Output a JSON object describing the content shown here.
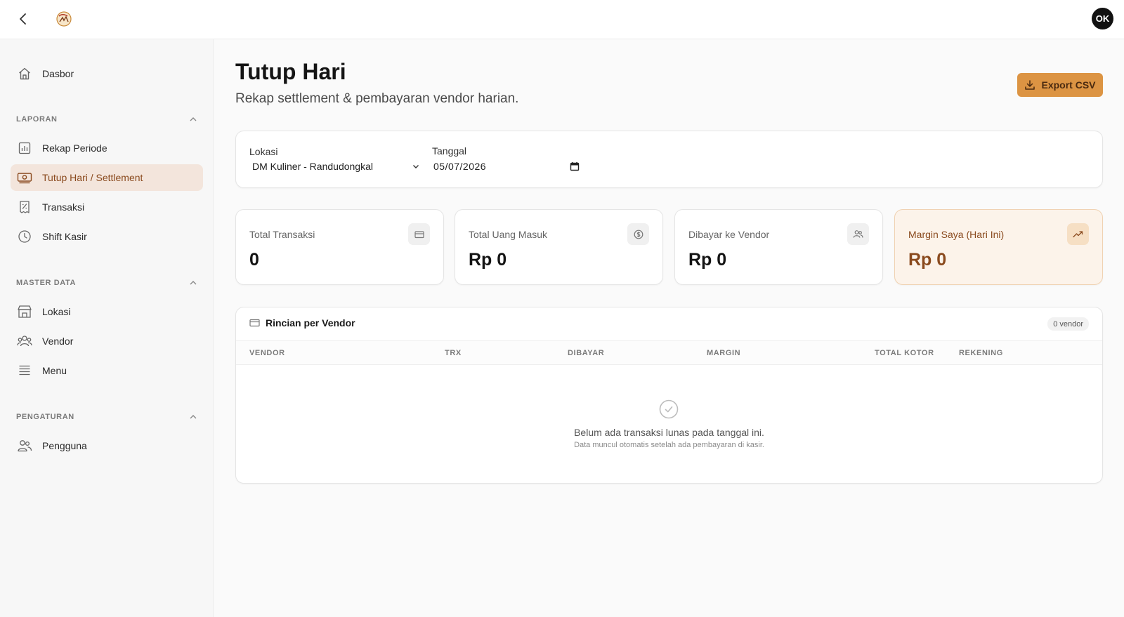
{
  "header": {
    "avatar_initials": "OK"
  },
  "sidebar": {
    "dashboard": "Dasbor",
    "sections": {
      "laporan": "LAPORAN",
      "master_data": "MASTER DATA",
      "pengaturan": "PENGATURAN"
    },
    "items": {
      "rekap_periode": "Rekap Periode",
      "tutup_hari": "Tutup Hari / Settlement",
      "transaksi": "Transaksi",
      "shift_kasir": "Shift Kasir",
      "lokasi": "Lokasi",
      "vendor": "Vendor",
      "menu": "Menu",
      "pengguna": "Pengguna"
    },
    "active_item": "tutup_hari"
  },
  "page": {
    "title": "Tutup Hari",
    "subtitle": "Rekap settlement & pembayaran vendor harian.",
    "export_label": "Export CSV"
  },
  "filters": {
    "location_label": "Lokasi",
    "location_value": "DM Kuliner - Randudongkal",
    "date_label": "Tanggal",
    "date_value": "05/07/2026"
  },
  "stats": [
    {
      "label": "Total Transaksi",
      "value": "0",
      "icon": "card-icon"
    },
    {
      "label": "Total Uang Masuk",
      "value": "Rp 0",
      "icon": "dollar-circle-icon"
    },
    {
      "label": "Dibayar ke Vendor",
      "value": "Rp 0",
      "icon": "users-icon"
    },
    {
      "label": "Margin Saya (Hari Ini)",
      "value": "Rp 0",
      "icon": "trending-up-icon"
    }
  ],
  "vendor_table": {
    "title": "Rincian per Vendor",
    "badge": "0 vendor",
    "columns": [
      "VENDOR",
      "TRX",
      "DIBAYAR",
      "MARGIN",
      "TOTAL KOTOR",
      "REKENING"
    ],
    "rows": [],
    "empty_title": "Belum ada transaksi lunas pada tanggal ini.",
    "empty_subtitle": "Data muncul otomatis setelah ada pembayaran di kasir."
  },
  "colors": {
    "accent": "#dc9443",
    "accent_dark": "#8a4a1e",
    "active_bg": "#f3e5dc",
    "highlight_bg": "#fcf3ea"
  }
}
